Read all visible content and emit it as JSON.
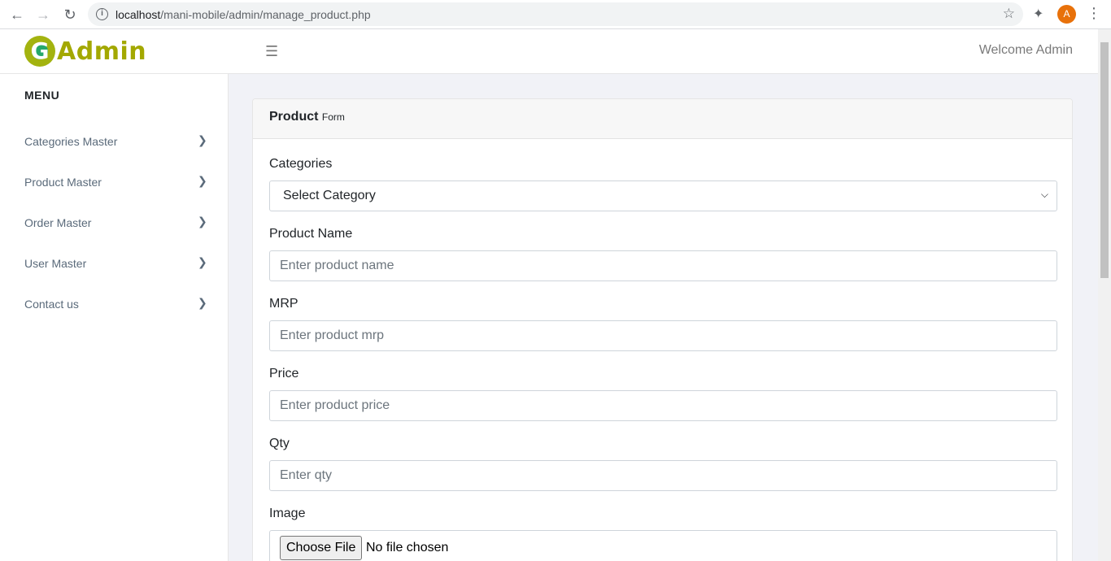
{
  "browser": {
    "url_host": "localhost",
    "url_path": "/mani-mobile/admin/manage_product.php",
    "profile_initial": "A"
  },
  "header": {
    "logo_letter": "G",
    "logo_text": "Admin",
    "welcome": "Welcome Admin"
  },
  "sidebar": {
    "menu_title": "MENU",
    "items": [
      {
        "label": "Categories Master"
      },
      {
        "label": "Product Master"
      },
      {
        "label": "Order Master"
      },
      {
        "label": "User Master"
      },
      {
        "label": "Contact us"
      }
    ]
  },
  "form": {
    "title_strong": "Product",
    "title_small": "Form",
    "categories_label": "Categories",
    "categories_selected": "Select Category",
    "product_name_label": "Product Name",
    "product_name_placeholder": "Enter product name",
    "mrp_label": "MRP",
    "mrp_placeholder": "Enter product mrp",
    "price_label": "Price",
    "price_placeholder": "Enter product price",
    "qty_label": "Qty",
    "qty_placeholder": "Enter qty",
    "image_label": "Image",
    "file_button": "Choose File",
    "file_status": "No file chosen"
  }
}
